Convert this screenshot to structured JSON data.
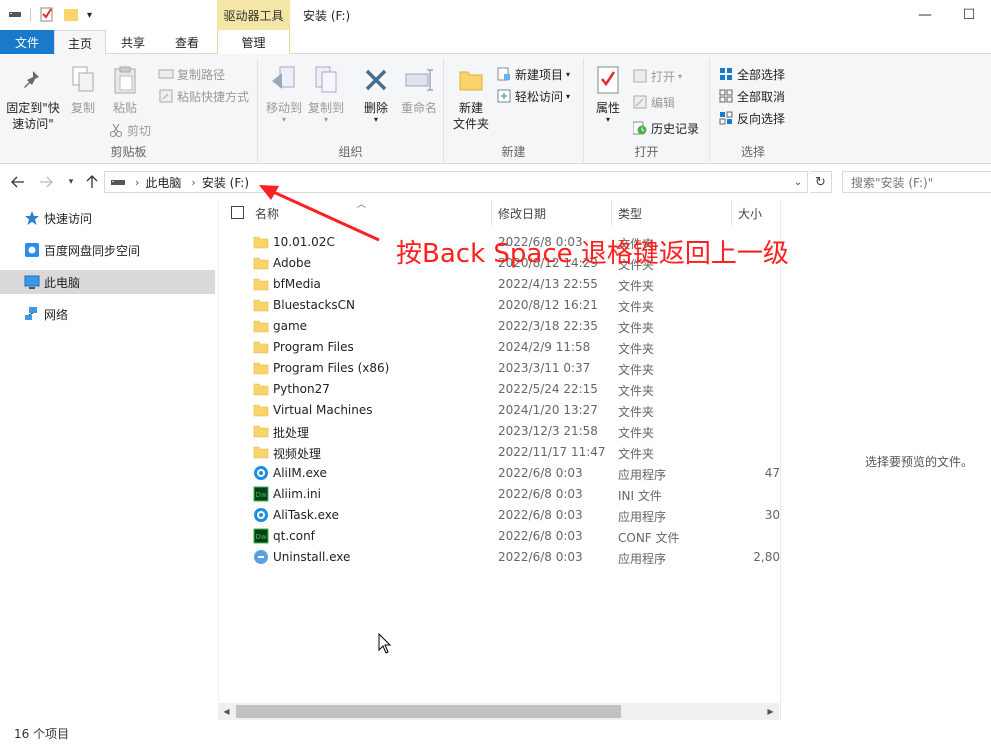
{
  "window": {
    "title": "安装 (F:)",
    "tool_tab_label": "驱动器工具",
    "minimize": "—",
    "maximize": "☐",
    "close": "✕"
  },
  "tabs": {
    "file": "文件",
    "home": "主页",
    "share": "共享",
    "view": "查看",
    "manage": "管理"
  },
  "ribbon": {
    "clipboard": {
      "label": "剪贴板",
      "pin_line1": "固定到\"快",
      "pin_line2": "速访问\"",
      "copy": "复制",
      "paste": "粘贴",
      "copy_path": "复制路径",
      "paste_shortcut": "粘贴快捷方式",
      "cut": "剪切"
    },
    "organize": {
      "label": "组织",
      "move_to": "移动到",
      "copy_to": "复制到",
      "delete": "删除",
      "rename": "重命名"
    },
    "new": {
      "label": "新建",
      "new_folder_line1": "新建",
      "new_folder_line2": "文件夹",
      "new_item": "新建项目",
      "easy_access": "轻松访问"
    },
    "open": {
      "label": "打开",
      "properties": "属性",
      "open": "打开",
      "edit": "编辑",
      "history": "历史记录"
    },
    "select": {
      "label": "选择",
      "select_all": "全部选择",
      "select_none": "全部取消",
      "invert": "反向选择"
    }
  },
  "address": {
    "crumbs": [
      "此电脑",
      "安装 (F:)"
    ],
    "search_placeholder": "搜索\"安装 (F:)\""
  },
  "navpane": {
    "items": [
      {
        "label": "快速访问",
        "icon": "star-icon"
      },
      {
        "label": "百度网盘同步空间",
        "icon": "baidu-sync-icon"
      },
      {
        "label": "此电脑",
        "icon": "computer-icon",
        "selected": true
      },
      {
        "label": "网络",
        "icon": "network-icon"
      }
    ]
  },
  "columns": {
    "name": "名称",
    "date": "修改日期",
    "type": "类型",
    "size": "大小"
  },
  "files": [
    {
      "name": "10.01.02C",
      "date": "2022/6/8 0:03",
      "type": "文件夹",
      "size": "",
      "icon": "folder"
    },
    {
      "name": "Adobe",
      "date": "2020/8/12 14:29",
      "type": "文件夹",
      "size": "",
      "icon": "folder"
    },
    {
      "name": "bfMedia",
      "date": "2022/4/13 22:55",
      "type": "文件夹",
      "size": "",
      "icon": "folder"
    },
    {
      "name": "BluestacksCN",
      "date": "2020/8/12 16:21",
      "type": "文件夹",
      "size": "",
      "icon": "folder"
    },
    {
      "name": "game",
      "date": "2022/3/18 22:35",
      "type": "文件夹",
      "size": "",
      "icon": "folder"
    },
    {
      "name": "Program Files",
      "date": "2024/2/9 11:58",
      "type": "文件夹",
      "size": "",
      "icon": "folder"
    },
    {
      "name": "Program Files (x86)",
      "date": "2023/3/11 0:37",
      "type": "文件夹",
      "size": "",
      "icon": "folder"
    },
    {
      "name": "Python27",
      "date": "2022/5/24 22:15",
      "type": "文件夹",
      "size": "",
      "icon": "folder"
    },
    {
      "name": "Virtual Machines",
      "date": "2024/1/20 13:27",
      "type": "文件夹",
      "size": "",
      "icon": "folder"
    },
    {
      "name": "批处理",
      "date": "2023/12/3 21:58",
      "type": "文件夹",
      "size": "",
      "icon": "folder"
    },
    {
      "name": "视频处理",
      "date": "2022/11/17 11:47",
      "type": "文件夹",
      "size": "",
      "icon": "folder"
    },
    {
      "name": "AliIM.exe",
      "date": "2022/6/8 0:03",
      "type": "应用程序",
      "size": "47",
      "icon": "aliim"
    },
    {
      "name": "Aliim.ini",
      "date": "2022/6/8 0:03",
      "type": "INI 文件",
      "size": "",
      "icon": "dw"
    },
    {
      "name": "AliTask.exe",
      "date": "2022/6/8 0:03",
      "type": "应用程序",
      "size": "30",
      "icon": "aliim"
    },
    {
      "name": "qt.conf",
      "date": "2022/6/8 0:03",
      "type": "CONF 文件",
      "size": "",
      "icon": "dw"
    },
    {
      "name": "Uninstall.exe",
      "date": "2022/6/8 0:03",
      "type": "应用程序",
      "size": "2,80",
      "icon": "uninstall"
    }
  ],
  "preview": {
    "empty_text": "选择要预览的文件。"
  },
  "status": {
    "count": "16 个项目"
  },
  "annotation": {
    "text": "按Back Space 退格键返回上一级",
    "color": "#ff2020"
  },
  "colors": {
    "accent": "#1979ca",
    "tool_tab": "#f4e6a6",
    "folder": "#f8d46a"
  }
}
